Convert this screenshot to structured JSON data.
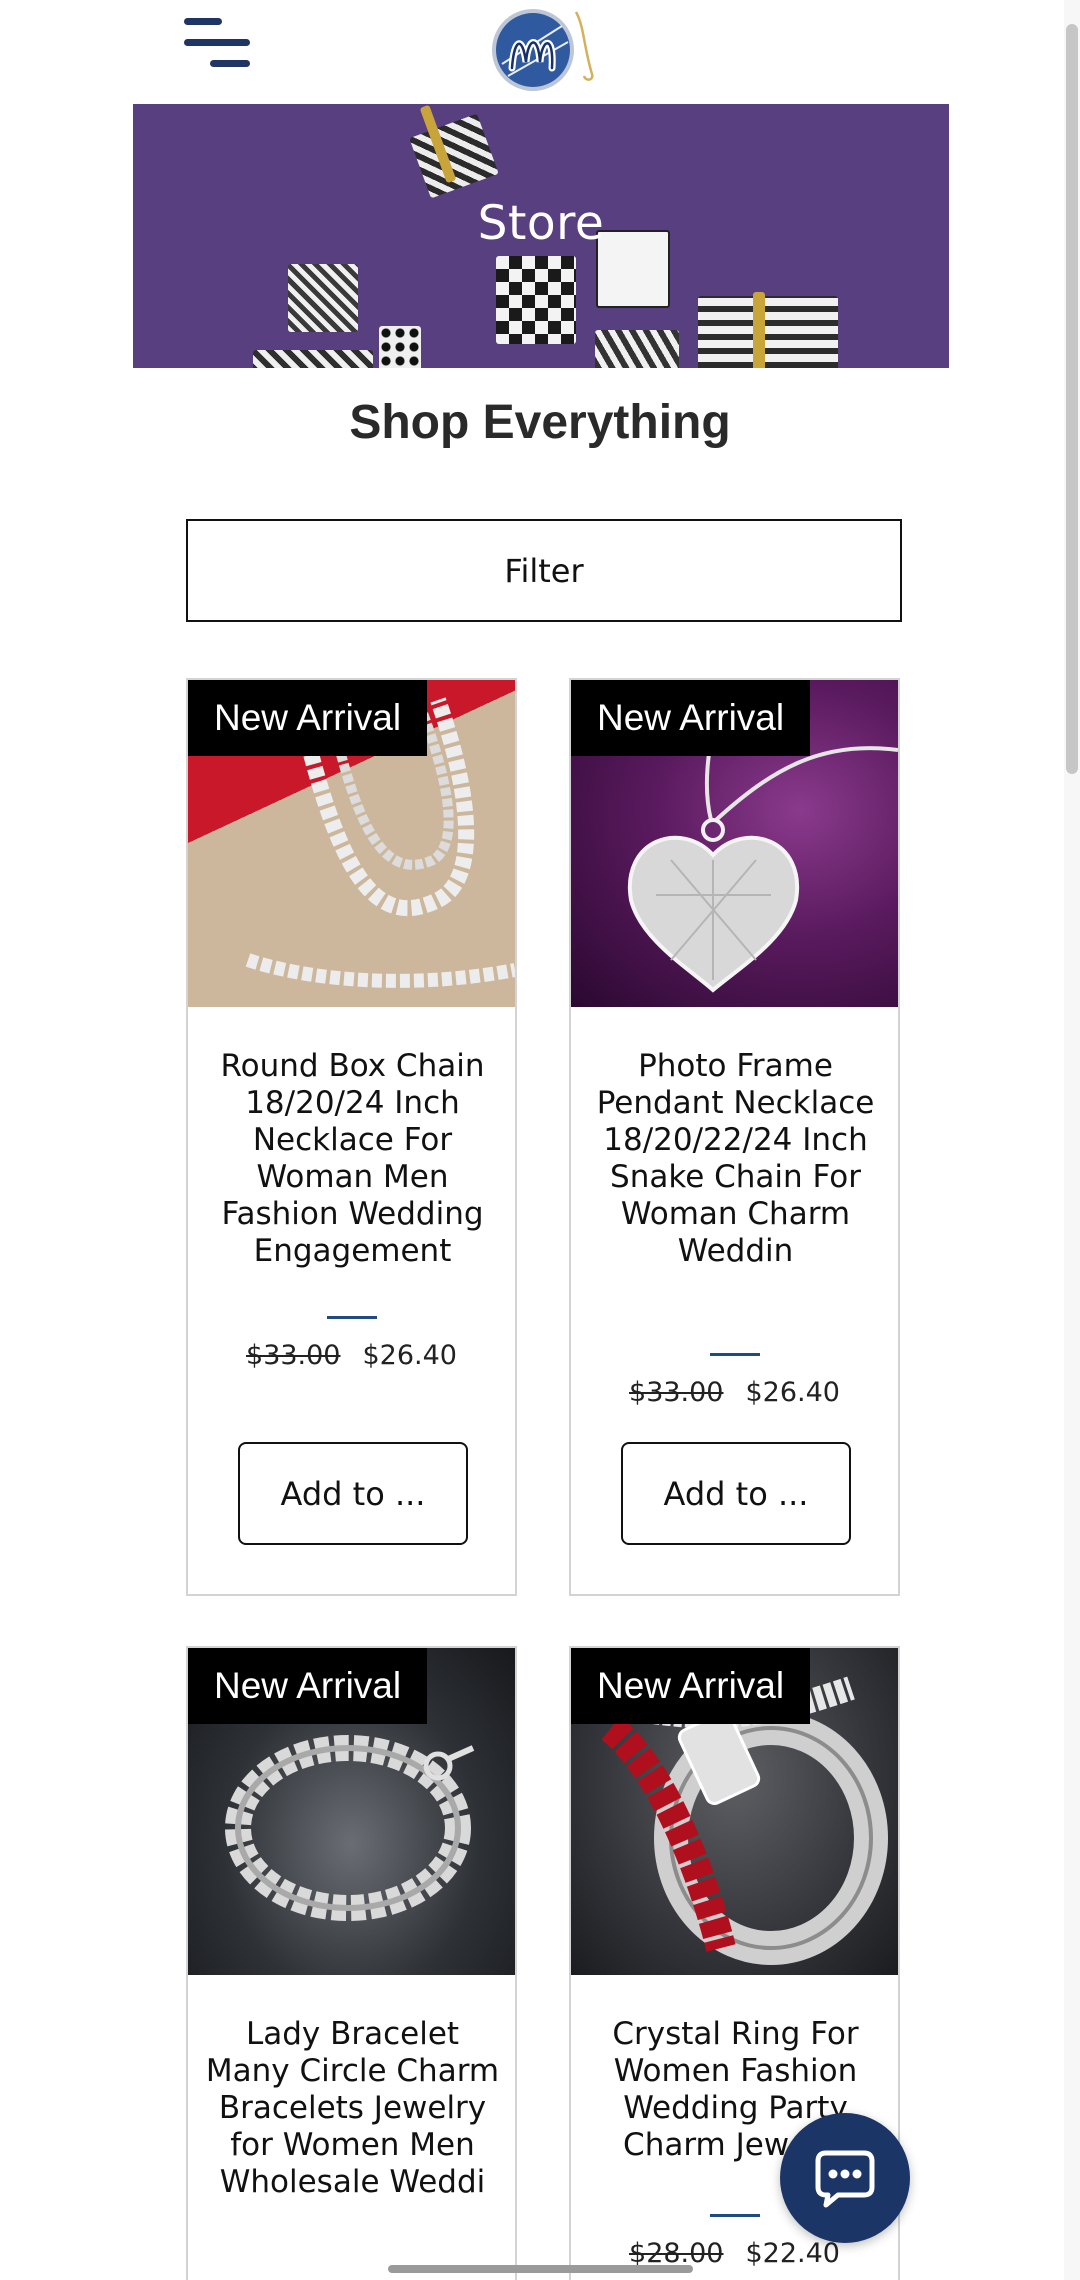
{
  "header": {
    "menu_icon": "hamburger-icon",
    "logo_icon": "brand-logo"
  },
  "hero": {
    "title": "Store"
  },
  "page": {
    "title": "Shop Everything",
    "filter_label": "Filter"
  },
  "products": [
    {
      "badge": "New Arrival",
      "title": "Round Box Chain 18/20/24 Inch Necklace For Woman Men Fashion Wedding Engagement",
      "old_price": "$33.00",
      "price": "$26.40",
      "button": "Add to ..."
    },
    {
      "badge": "New Arrival",
      "title": "Photo Frame Pendant Necklace 18/20/22/24 Inch Snake Chain For Woman Charm Weddin",
      "old_price": "$33.00",
      "price": "$26.40",
      "button": "Add to ..."
    },
    {
      "badge": "New Arrival",
      "title": "Lady Bracelet Many Circle Charm Bracelets Jewelry for Women Men Wholesale Weddi",
      "old_price": "",
      "price": "",
      "button": ""
    },
    {
      "badge": "New Arrival",
      "title": "Crystal Ring For Women Fashion Wedding Party Charm Jewelry",
      "old_price": "$28.00",
      "price": "$22.40",
      "button": ""
    }
  ],
  "chat": {
    "icon": "chat-bubble-icon"
  },
  "colors": {
    "hero_bg": "#573f80",
    "brand_navy": "#1a3566",
    "accent_divider": "#1f4a82"
  }
}
